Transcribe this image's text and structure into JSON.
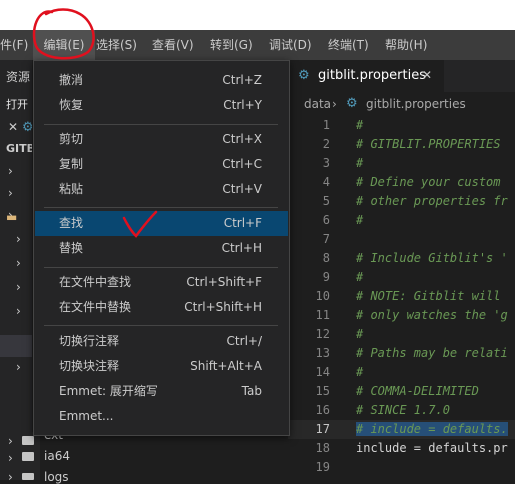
{
  "menubar": {
    "file": "件(F)",
    "edit": "编辑(E)",
    "selection": "选择(S)",
    "view": "查看(V)",
    "go": "转到(G)",
    "debug": "调试(D)",
    "terminal": "终端(T)",
    "help": "帮助(H)"
  },
  "sidebar": {
    "explorer_title": "资源",
    "open_editors": "打开",
    "root": "GITB",
    "folder_ext": "ext",
    "folder_ia64": "ia64",
    "folder_logs": "logs"
  },
  "editor": {
    "tab_label": "gitblit.properties",
    "breadcrumb": [
      "data",
      "gitblit.properties"
    ],
    "lines": [
      {
        "n": "1",
        "text": "#"
      },
      {
        "n": "2",
        "text": "# GITBLIT.PROPERTIES"
      },
      {
        "n": "3",
        "text": "#"
      },
      {
        "n": "4",
        "text": "# Define your custom"
      },
      {
        "n": "5",
        "text": "# other properties fr"
      },
      {
        "n": "6",
        "text": "#"
      },
      {
        "n": "7",
        "text": ""
      },
      {
        "n": "8",
        "text": "# Include Gitblit's '"
      },
      {
        "n": "9",
        "text": "#"
      },
      {
        "n": "10",
        "text": "# NOTE: Gitblit will"
      },
      {
        "n": "11",
        "text": "# only watches the 'g"
      },
      {
        "n": "12",
        "text": "#"
      },
      {
        "n": "13",
        "text": "# Paths may be relati"
      },
      {
        "n": "14",
        "text": "#"
      },
      {
        "n": "15",
        "text": "# COMMA-DELIMITED"
      },
      {
        "n": "16",
        "text": "# SINCE 1.7.0"
      },
      {
        "n": "17",
        "text": "# include = defaults."
      },
      {
        "n": "18",
        "text": "include = defaults.pr"
      },
      {
        "n": "19",
        "text": ""
      }
    ]
  },
  "edit_menu": {
    "items": [
      {
        "label": "撤消",
        "key": "Ctrl+Z"
      },
      {
        "label": "恢复",
        "key": "Ctrl+Y"
      },
      {
        "label": "剪切",
        "key": "Ctrl+X"
      },
      {
        "label": "复制",
        "key": "Ctrl+C"
      },
      {
        "label": "粘贴",
        "key": "Ctrl+V"
      },
      {
        "label": "查找",
        "key": "Ctrl+F"
      },
      {
        "label": "替换",
        "key": "Ctrl+H"
      },
      {
        "label": "在文件中查找",
        "key": "Ctrl+Shift+F"
      },
      {
        "label": "在文件中替换",
        "key": "Ctrl+Shift+H"
      },
      {
        "label": "切换行注释",
        "key": "Ctrl+/"
      },
      {
        "label": "切换块注释",
        "key": "Shift+Alt+A"
      },
      {
        "label": "Emmet: 展开缩写",
        "key": "Tab"
      },
      {
        "label": "Emmet...",
        "key": ""
      }
    ]
  },
  "colors": {
    "menu_bg": "#252526",
    "selection": "#094771",
    "annotation_red": "#e0101e",
    "comment": "#6a9955"
  }
}
